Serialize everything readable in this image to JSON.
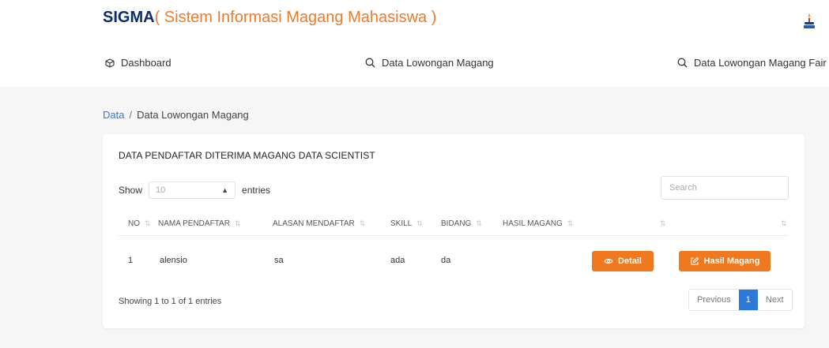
{
  "header": {
    "brand_main": "SIGMA",
    "brand_sub": "( Sistem Informasi Magang Mahasiswa )",
    "logo_icon": "university-logo-icon"
  },
  "nav": {
    "items": [
      {
        "label": "Dashboard",
        "icon": "cube-icon"
      },
      {
        "label": "Data Lowongan Magang",
        "icon": "search-icon"
      },
      {
        "label": "Data Lowongan Magang Fair",
        "icon": "search-icon"
      }
    ]
  },
  "breadcrumb": {
    "root": "Data",
    "separator": "/",
    "current": "Data Lowongan Magang"
  },
  "card": {
    "title": "DATA PENDAFTAR DITERIMA MAGANG DATA SCIENTIST",
    "show_label": "Show",
    "entries_value": "10",
    "entries_label": "entries",
    "search_placeholder": "Search",
    "columns": [
      "NO",
      "NAMA PENDAFTAR",
      "ALASAN MENDAFTAR",
      "SKILL",
      "BIDANG",
      "HASIL MAGANG",
      "",
      ""
    ],
    "rows": [
      {
        "no": "1",
        "nama": "alensio",
        "alasan": "sa",
        "skill": "ada",
        "bidang": "da",
        "hasil": "",
        "detail_label": "Detail",
        "hasil_label": "Hasil Magang"
      }
    ],
    "info": "Showing 1 to 1 of 1 entries",
    "pagination": {
      "previous": "Previous",
      "current_page": "1",
      "next": "Next"
    }
  },
  "colors": {
    "brand_navy": "#0c2d6b",
    "brand_orange": "#f07a2a",
    "button_orange": "#f0781e",
    "link_blue": "#2f7ad6",
    "page_active": "#2b7ad8"
  }
}
